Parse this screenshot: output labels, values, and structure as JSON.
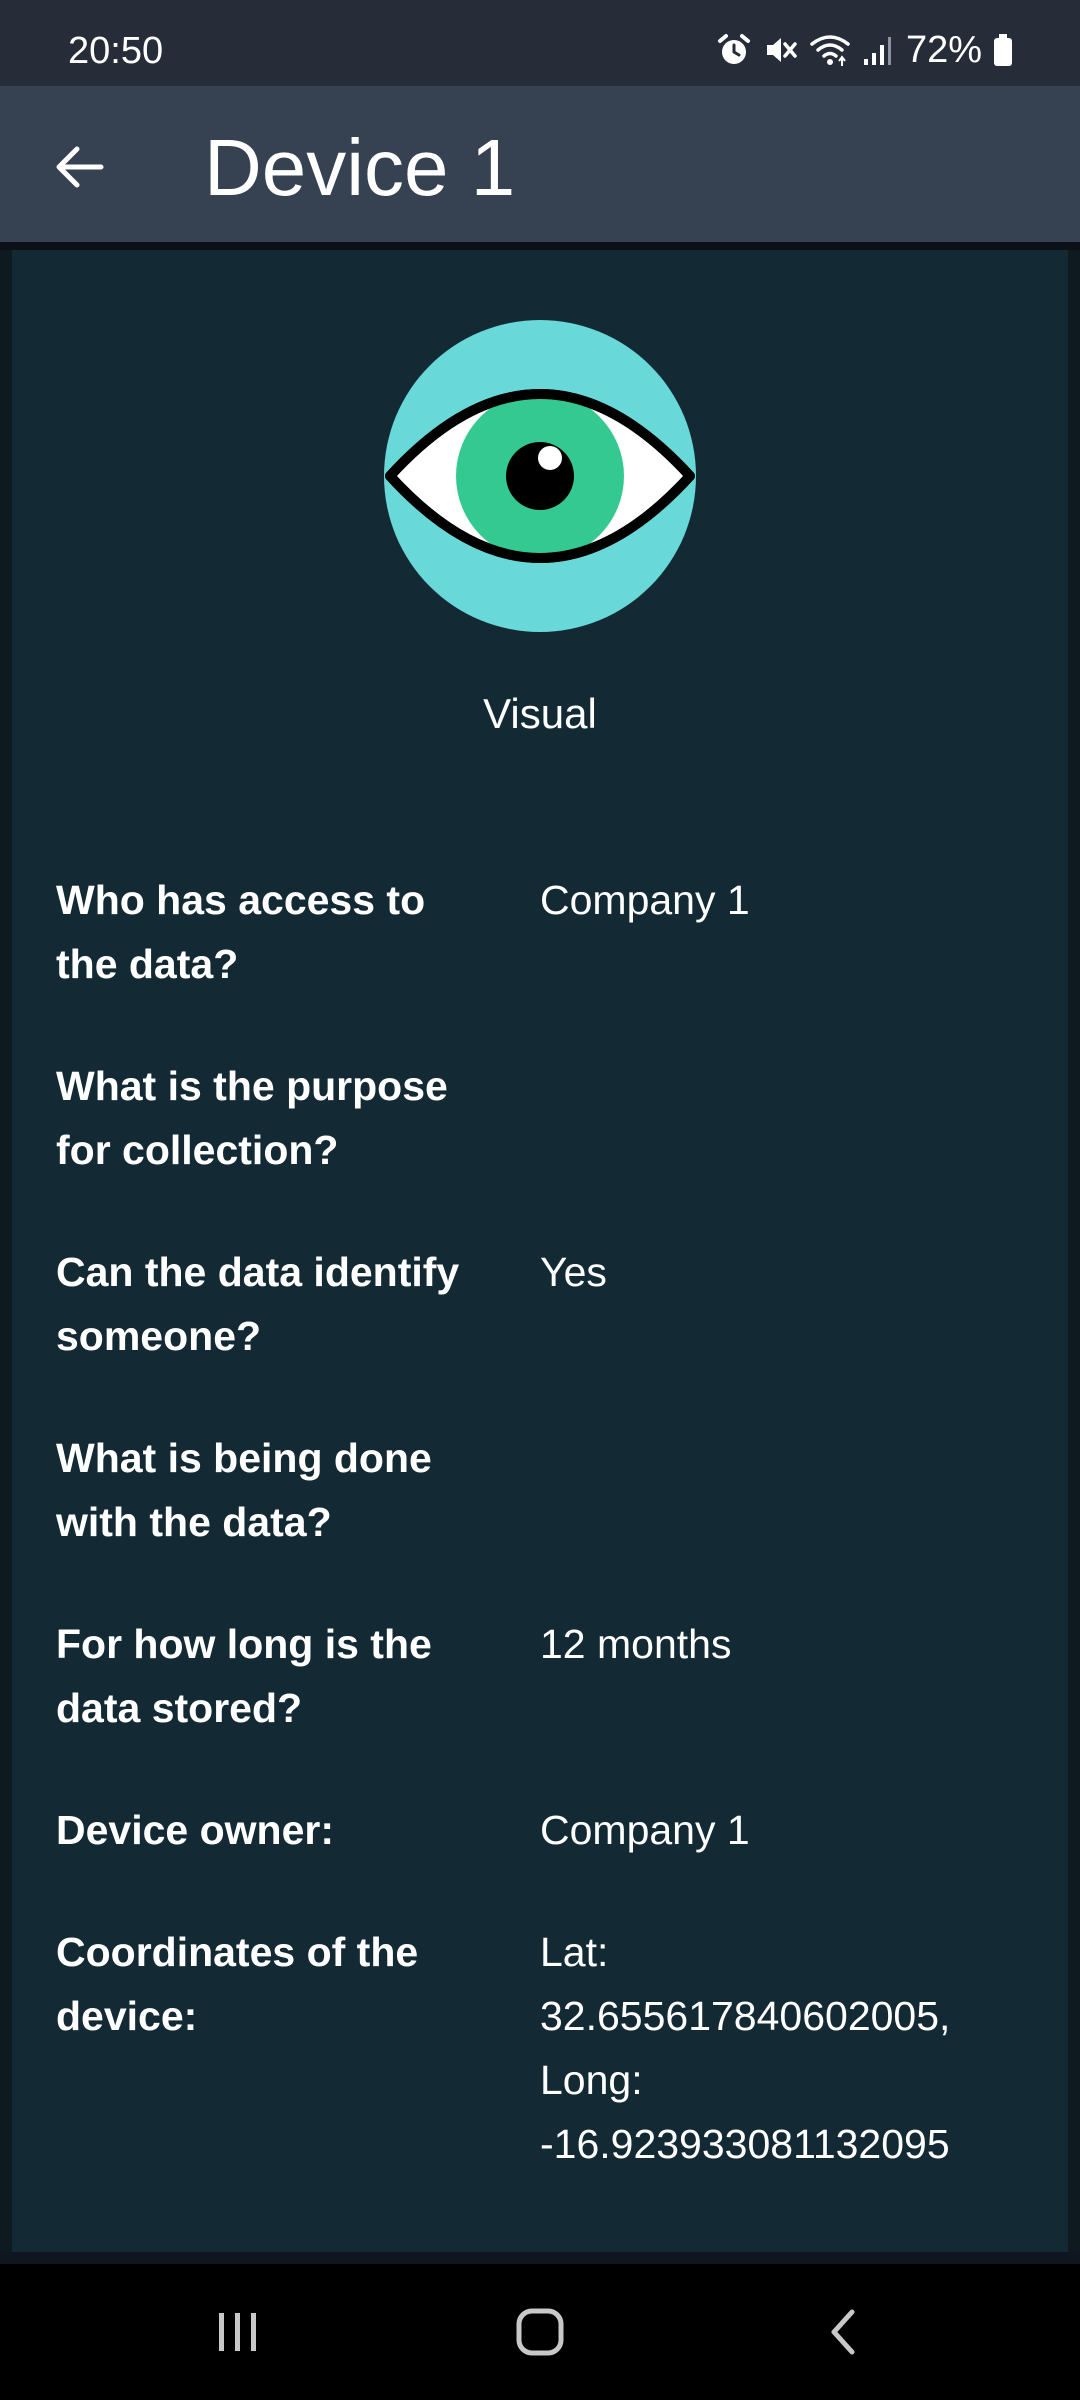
{
  "status_bar": {
    "time": "20:50",
    "battery_percent": "72%",
    "icons": [
      "alarm-icon",
      "mute-icon",
      "wifi-icon",
      "signal-icon",
      "battery-icon"
    ]
  },
  "app_bar": {
    "title": "Device 1",
    "back_icon": "arrow-left-icon"
  },
  "device": {
    "category_icon": "eye-icon",
    "category_label": "Visual",
    "details": [
      {
        "question": "Who has access to the data?",
        "answer": "Company 1"
      },
      {
        "question": "What is the purpose for collection?",
        "answer": ""
      },
      {
        "question": "Can the data identify someone?",
        "answer": "Yes"
      },
      {
        "question": "What is being done with the data?",
        "answer": ""
      },
      {
        "question": "For how long is the data stored?",
        "answer": "12 months"
      },
      {
        "question": "Device owner:",
        "answer": "Company 1"
      },
      {
        "question": "Coordinates of the device:",
        "answer_lines": [
          "Lat:",
          "32.655617840602005,",
          "Long:",
          "-16.923933081132095"
        ]
      }
    ]
  },
  "nav_bar": {
    "buttons": [
      "recents-icon",
      "home-icon",
      "back-icon"
    ]
  },
  "colors": {
    "status_bar_bg": "#262d38",
    "app_bar_bg": "#364152",
    "card_bg": "#132a35",
    "eye_circle": "#68d8d8",
    "iris": "#33c990"
  }
}
